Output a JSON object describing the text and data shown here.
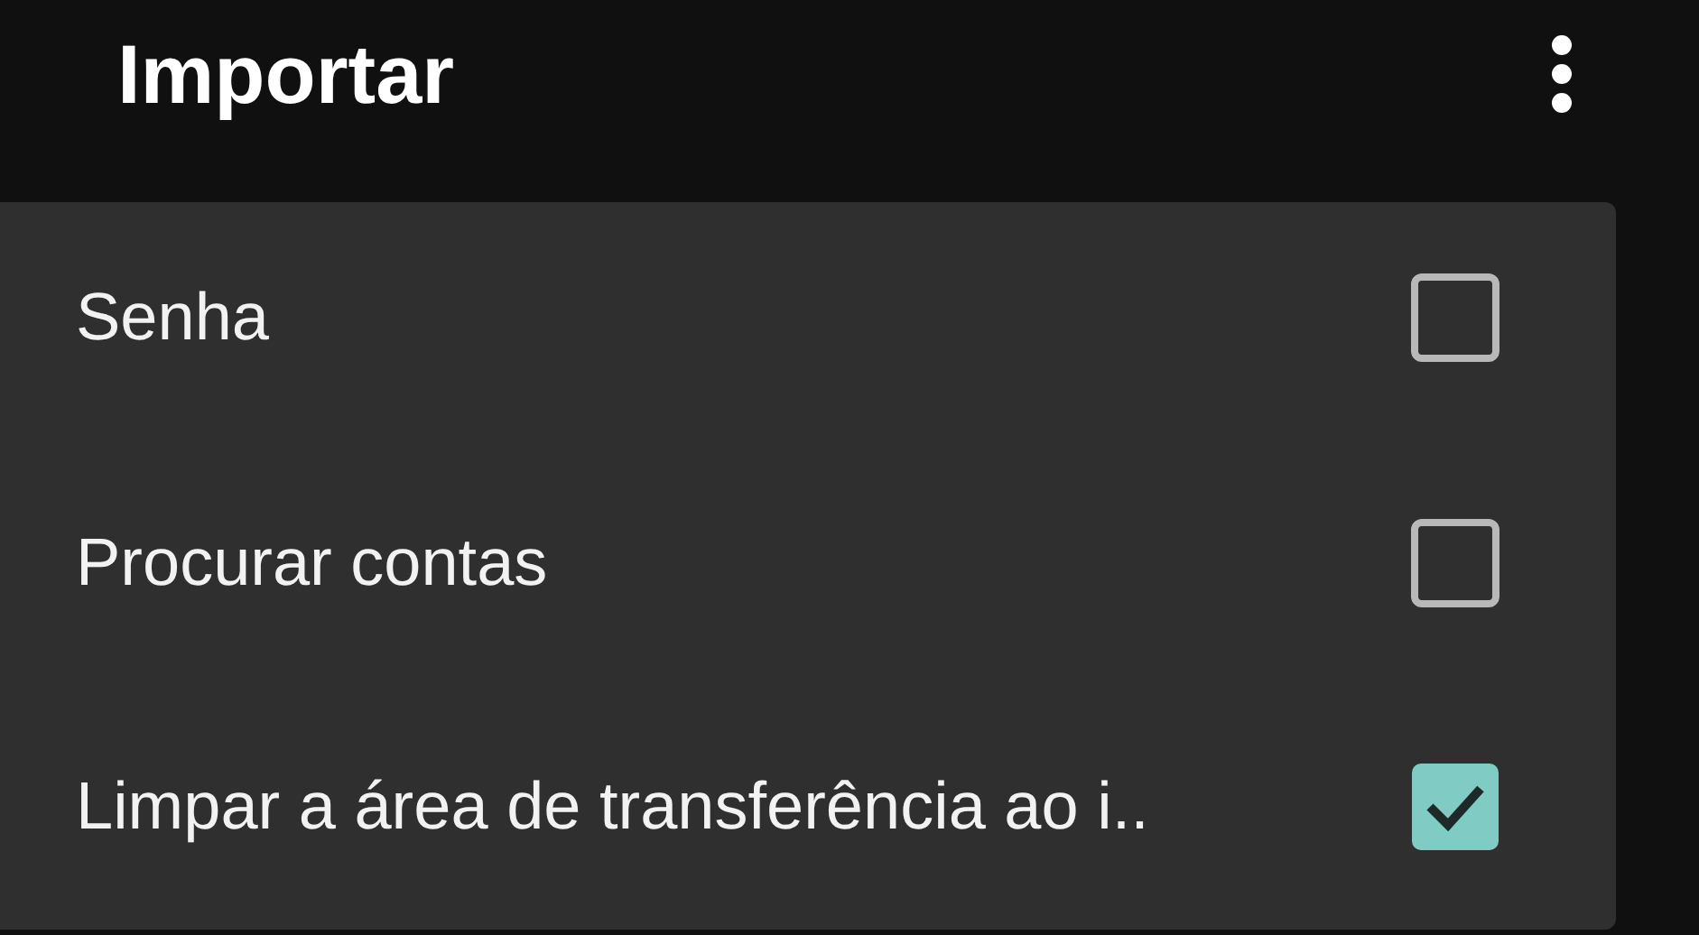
{
  "app_bar": {
    "title": "Importar"
  },
  "menu": {
    "items": [
      {
        "label": "Senha",
        "checked": false
      },
      {
        "label": "Procurar contas",
        "checked": false
      },
      {
        "label": "Limpar a área de transferência ao i..",
        "checked": true
      }
    ]
  }
}
